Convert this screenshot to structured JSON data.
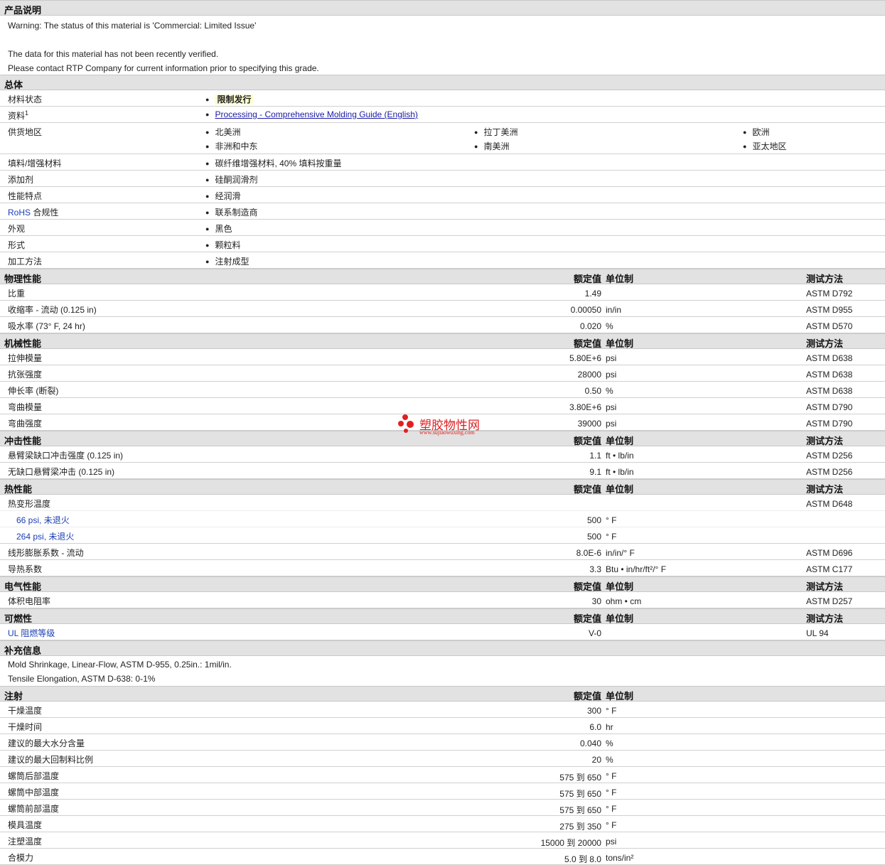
{
  "desc": {
    "title": "产品说明",
    "lines": [
      "Warning: The status of this material is 'Commercial: Limited Issue'",
      "",
      "The data for this material has not been recently verified.",
      "Please contact RTP Company for current information prior to specifying this grade."
    ]
  },
  "general": {
    "title": "总体",
    "rows": [
      {
        "label": "材料状态",
        "items": [
          "限制发行"
        ],
        "highlight": true
      },
      {
        "label": "资料",
        "sup": "1",
        "items": [
          "Processing - Comprehensive Molding Guide (English)"
        ],
        "link": true
      },
      {
        "label": "供货地区",
        "items": [
          "北美洲",
          "拉丁美洲",
          "欧洲",
          "非洲和中东",
          "南美洲",
          "亚太地区"
        ]
      },
      {
        "label": "填料/增强材料",
        "items": [
          "碳纤维增强材料, 40% 填料按重量"
        ]
      },
      {
        "label": "添加剂",
        "items": [
          "硅酮润滑剂"
        ]
      },
      {
        "label": "性能特点",
        "items": [
          "经润滑"
        ]
      },
      {
        "label_blue": "RoHS",
        "label": " 合规性",
        "items": [
          "联系制造商"
        ]
      },
      {
        "label": "外观",
        "items": [
          "黑色"
        ]
      },
      {
        "label": "形式",
        "items": [
          "颗粒料"
        ]
      },
      {
        "label": "加工方法",
        "items": [
          "注射成型"
        ]
      }
    ]
  },
  "headers": {
    "value": "额定值",
    "unit": "单位制",
    "method": "测试方法"
  },
  "sections": [
    {
      "title": "物理性能",
      "rows": [
        {
          "label": "比重",
          "value": "1.49",
          "unit": "",
          "method": "ASTM D792"
        },
        {
          "label": "收缩率 - 流动  (0.125 in)",
          "value": "0.00050",
          "unit": "in/in",
          "method": "ASTM D955"
        },
        {
          "label": "吸水率  (73° F, 24 hr)",
          "value": "0.020",
          "unit": "%",
          "method": "ASTM D570"
        }
      ]
    },
    {
      "title": "机械性能",
      "rows": [
        {
          "label": "拉伸模量",
          "value": "5.80E+6",
          "unit": "psi",
          "method": "ASTM D638"
        },
        {
          "label": "抗张强度",
          "value": "28000",
          "unit": "psi",
          "method": "ASTM D638"
        },
        {
          "label": "伸长率  (断裂)",
          "value": "0.50",
          "unit": "%",
          "method": "ASTM D638"
        },
        {
          "label": "弯曲模量",
          "value": "3.80E+6",
          "unit": "psi",
          "method": "ASTM D790"
        },
        {
          "label": "弯曲强度",
          "value": "39000",
          "unit": "psi",
          "method": "ASTM D790"
        }
      ]
    },
    {
      "title": "冲击性能",
      "rows": [
        {
          "label": "悬臂梁缺口冲击强度  (0.125 in)",
          "value": "1.1",
          "unit": "ft • lb/in",
          "method": "ASTM D256"
        },
        {
          "label": "无缺口悬臂梁冲击  (0.125 in)",
          "value": "9.1",
          "unit": "ft • lb/in",
          "method": "ASTM D256"
        }
      ]
    },
    {
      "title": "热性能",
      "rows": [
        {
          "label": "热变形温度",
          "value": "",
          "unit": "",
          "method": "ASTM D648",
          "light": true
        },
        {
          "label": "66 psi, 未退火",
          "value": "500",
          "unit": "° F",
          "method": "",
          "indent": true,
          "light": true
        },
        {
          "label": "264 psi, 未退火",
          "value": "500",
          "unit": "° F",
          "method": "",
          "indent": true
        },
        {
          "label": "线形膨胀系数 - 流动",
          "value": "8.0E-6",
          "unit": "in/in/° F",
          "method": "ASTM D696"
        },
        {
          "label": "导热系数",
          "value": "3.3",
          "unit": "Btu • in/hr/ft²/° F",
          "method": "ASTM C177"
        }
      ]
    },
    {
      "title": "电气性能",
      "rows": [
        {
          "label": "体积电阻率",
          "value": "30",
          "unit": "ohm • cm",
          "method": "ASTM D257"
        }
      ]
    },
    {
      "title": "可燃性",
      "rows": [
        {
          "label": "UL 阻燃等级",
          "value": "V-0",
          "unit": "",
          "method": "UL 94"
        }
      ]
    }
  ],
  "supp": {
    "title": "补充信息",
    "lines": [
      "Mold Shrinkage, Linear-Flow, ASTM D-955, 0.25in.: 1mil/in.",
      "Tensile Elongation, ASTM D-638: 0-1%"
    ]
  },
  "injection": {
    "title": "注射",
    "rows": [
      {
        "label": "干燥温度",
        "value": "300",
        "unit": "° F"
      },
      {
        "label": "干燥时间",
        "value": "6.0",
        "unit": "hr"
      },
      {
        "label": "建议的最大水分含量",
        "value": "0.040",
        "unit": "%"
      },
      {
        "label": "建议的最大回制料比例",
        "value": "20",
        "unit": "%"
      },
      {
        "label": "螺筒后部温度",
        "value": "575 到  650",
        "unit": "° F"
      },
      {
        "label": "螺筒中部温度",
        "value": "575 到  650",
        "unit": "° F"
      },
      {
        "label": "螺筒前部温度",
        "value": "575 到  650",
        "unit": "° F"
      },
      {
        "label": "模具温度",
        "value": "275 到  350",
        "unit": "° F"
      },
      {
        "label": "注塑温度",
        "value": "15000 到  20000",
        "unit": "psi"
      },
      {
        "label": "合模力",
        "value": "5.0 到  8.0",
        "unit": "tons/in²"
      }
    ]
  },
  "watermark": {
    "name": "塑胶物性网",
    "url": "www.sujiaowuxing.com"
  }
}
